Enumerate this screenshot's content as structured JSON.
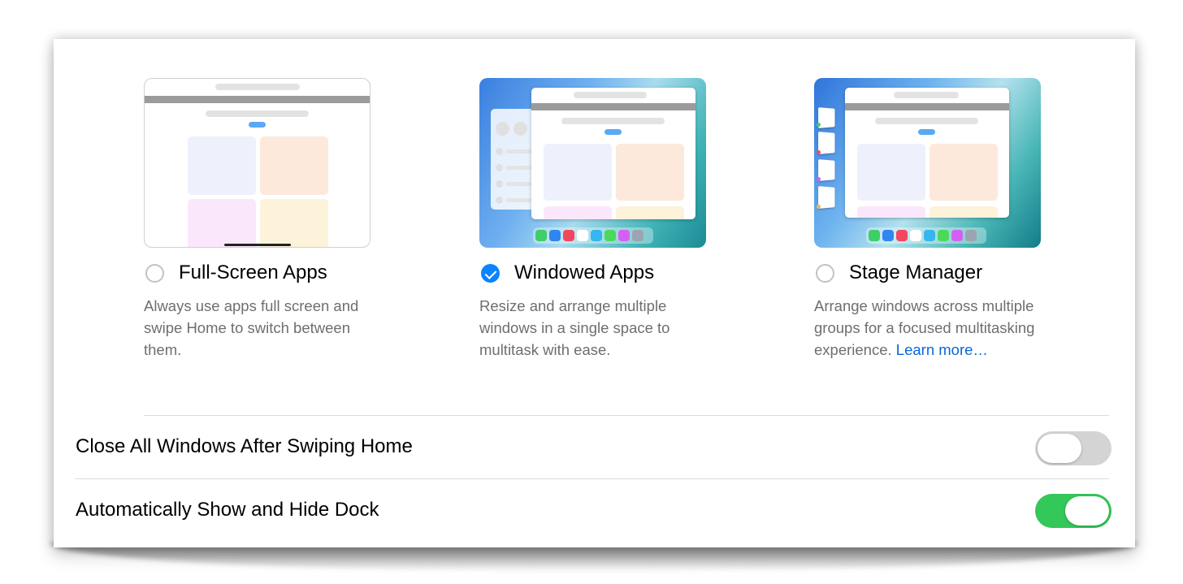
{
  "options": [
    {
      "label": "Full-Screen Apps",
      "selected": false,
      "description": "Always use apps full screen and swipe Home to switch between them."
    },
    {
      "label": "Windowed Apps",
      "selected": true,
      "description": "Resize and arrange multiple windows in a single space to multitask with ease."
    },
    {
      "label": "Stage Manager",
      "selected": false,
      "description": "Arrange windows across multiple groups for a focused multitasking experience.",
      "link": "Learn more…"
    }
  ],
  "settings": [
    {
      "label": "Close All Windows After Swiping Home",
      "enabled": false
    },
    {
      "label": "Automatically Show and Hide Dock",
      "enabled": true
    }
  ],
  "colors": {
    "accent": "#0a84ff",
    "toggle_on": "#34c759",
    "toggle_off": "#d4d4d4",
    "link": "#0a67d6"
  }
}
